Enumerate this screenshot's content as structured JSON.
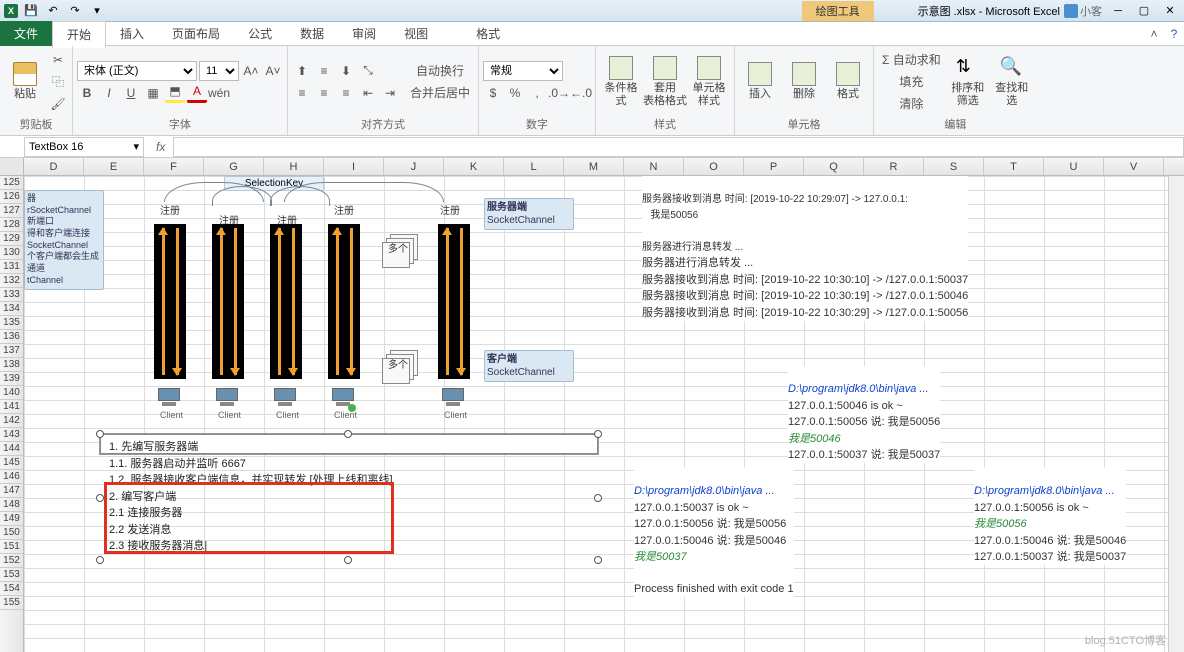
{
  "titlebar": {
    "app_label": "X",
    "context_tool": "绘图工具",
    "doc_title": "示意图 .xlsx - Microsoft Excel",
    "user_name": "小客",
    "minimize": "─",
    "maximize": "▢",
    "close": "✕"
  },
  "tabs": {
    "file": "文件",
    "home": "开始",
    "insert": "插入",
    "layout": "页面布局",
    "formulas": "公式",
    "data": "数据",
    "review": "审阅",
    "view": "视图",
    "format": "格式"
  },
  "ribbon": {
    "clipboard": {
      "label": "剪贴板",
      "paste": "粘贴"
    },
    "font": {
      "label": "字体",
      "font_name": "宋体 (正文)",
      "font_size": "11",
      "bold": "B",
      "italic": "I",
      "underline": "U"
    },
    "align": {
      "label": "对齐方式",
      "wrap": "自动换行",
      "merge": "合并后居中"
    },
    "number": {
      "label": "数字",
      "fmt": "常规"
    },
    "styles": {
      "label": "样式",
      "cond": "条件格式",
      "tbl": "套用\n表格格式",
      "cell": "单元格样式"
    },
    "cells": {
      "label": "单元格",
      "insert": "插入",
      "delete": "删除",
      "format": "格式"
    },
    "editing": {
      "label": "编辑",
      "sum": "Σ 自动求和",
      "fill": "填充",
      "clear": "清除",
      "sort": "排序和筛选",
      "find": "查找和选"
    }
  },
  "formula": {
    "name_box": "TextBox 16",
    "fx": "fx"
  },
  "cols": [
    "D",
    "E",
    "F",
    "G",
    "H",
    "I",
    "J",
    "K",
    "L",
    "M",
    "N",
    "O",
    "P",
    "Q",
    "R",
    "S",
    "T",
    "U",
    "V"
  ],
  "rows_start": 125,
  "rows_end": 155,
  "diagram": {
    "selection_key": "SelectionKey",
    "register": "注册",
    "multi": "多个",
    "server_box": {
      "l1": "服务器端",
      "l2": "SocketChannel"
    },
    "client_box": {
      "l1": "客户端",
      "l2": "SocketChannel"
    },
    "left_box": {
      "l1": "器",
      "l2": "rSocketChannel",
      "l3": "新端口",
      "l4": "得和客户端连接",
      "l5": "SocketChannel",
      "l6": "个客户端都会生成",
      "l7": "通道",
      "l8": "tChannel"
    },
    "client": "Client",
    "textbox_lines": [
      "1. 先编写服务器端",
      "1.1. 服务器启动并监听 6667",
      "1.2. 服务器接收客户端信息，并实现转发 [处理上线和离线]",
      "2. 编写客户端",
      "2.1 连接服务器",
      "2.2 发送消息",
      "2.3 接收服务器消息|"
    ]
  },
  "console_top": [
    "服务器接收到消息 时间: [2019-10-22 10:29:07] -> 127.0.0.1:",
    "   我是50056",
    "",
    "服务器进行消息转发 ...",
    "服务器进行消息转发 ...",
    "服务器接收到消息 时间: [2019-10-22 10:30:10] -> /127.0.0.1:50037",
    "服务器接收到消息 时间: [2019-10-22 10:30:19] -> /127.0.0.1:50046",
    "服务器接收到消息 时间: [2019-10-22 10:30:29] -> /127.0.0.1:50056"
  ],
  "console_mid_right": {
    "header": "D:\\program\\jdk8.0\\bin\\java ...",
    "lines": [
      "127.0.0.1:50046 is ok ~",
      "127.0.0.1:50056 说: 我是50056"
    ],
    "green": "我是50046",
    "lines2": [
      "127.0.0.1:50037 说: 我是50037"
    ]
  },
  "console_bottom_left": {
    "header": "D:\\program\\jdk8.0\\bin\\java ...",
    "lines": [
      "127.0.0.1:50037 is ok ~",
      "127.0.0.1:50056 说: 我是50056",
      "127.0.0.1:50046 说: 我是50046"
    ],
    "green": "我是50037",
    "exit": "Process finished with exit code 1"
  },
  "console_bottom_right": {
    "header": "D:\\program\\jdk8.0\\bin\\java ...",
    "lines": [
      "127.0.0.1:50056 is ok ~"
    ],
    "green": "我是50056",
    "lines2": [
      "127.0.0.1:50046 说: 我是50046",
      "127.0.0.1:50037 说: 我是50037"
    ]
  },
  "watermark": "blog.51CTO博客"
}
